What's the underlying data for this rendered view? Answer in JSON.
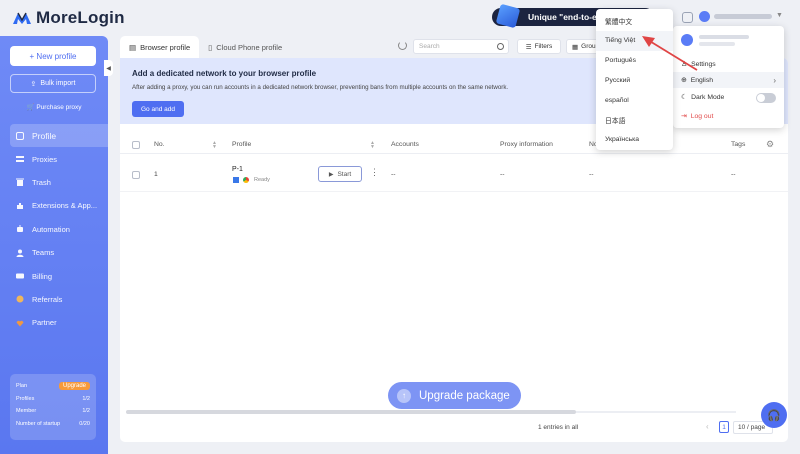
{
  "app": {
    "name": "MoreLogin"
  },
  "header": {
    "promo_text": "Unique \"end-to-end e"
  },
  "sidebar": {
    "new_profile": "+ New profile",
    "bulk_import": "Bulk import",
    "purchase_proxy": "Purchase proxy",
    "items": [
      {
        "label": "Profile",
        "icon": "profile-icon",
        "active": true
      },
      {
        "label": "Proxies",
        "icon": "proxies-icon"
      },
      {
        "label": "Trash",
        "icon": "trash-icon"
      },
      {
        "label": "Extensions & App...",
        "icon": "extensions-icon"
      },
      {
        "label": "Automation",
        "icon": "automation-icon"
      },
      {
        "label": "Teams",
        "icon": "teams-icon"
      },
      {
        "label": "Billing",
        "icon": "billing-icon"
      },
      {
        "label": "Referrals",
        "icon": "referrals-icon"
      },
      {
        "label": "Partner",
        "icon": "partner-icon"
      }
    ],
    "plan": {
      "plan_label": "Plan",
      "upgrade_label": "Upgrade",
      "profiles_label": "Profiles",
      "profiles_value": "1/2",
      "member_label": "Member",
      "member_value": "1/2",
      "startups_label": "Number of startup",
      "startups_value": "0/20"
    }
  },
  "tabs": [
    {
      "label": "Browser profile",
      "active": true
    },
    {
      "label": "Cloud Phone profile",
      "active": false
    }
  ],
  "toolbar": {
    "search_placeholder": "Search",
    "filters_label": "Filters",
    "group_label": "Grou"
  },
  "banner": {
    "title": "Add a dedicated network to your browser profile",
    "text": "After adding a proxy, you can run accounts in a dedicated network browser, preventing bans from multiple accounts on the same network.",
    "button": "Go and add"
  },
  "table": {
    "columns": [
      "No.",
      "Profile",
      "Accounts",
      "Proxy information",
      "No",
      "Tags"
    ],
    "rows": [
      {
        "no": "1",
        "profile": "P-1",
        "status": "Ready",
        "start": "Start",
        "accounts": "--",
        "proxy": "--",
        "notes": "--",
        "tags": "--"
      }
    ]
  },
  "footer": {
    "entries": "1 entries in all",
    "page": "1",
    "page_size": "10 / page"
  },
  "upgrade_package": "Upgrade package",
  "language_menu": {
    "items": [
      "繁體中文",
      "Tiếng Việt",
      "Português",
      "Русский",
      "español",
      "日本語",
      "Українська"
    ],
    "highlighted": "Tiếng Việt"
  },
  "account_menu": {
    "settings": "Settings",
    "language": "English",
    "dark_mode": "Dark Mode",
    "dark_mode_on": false,
    "logout": "Log out"
  },
  "colors": {
    "accent": "#4f6ef1",
    "sidebar": "#6f8af6",
    "promo_bg": "#1c2440",
    "upgrade_badge": "#f79a3a",
    "logout": "#e14a4a",
    "annotation_arrow": "#e04545"
  }
}
